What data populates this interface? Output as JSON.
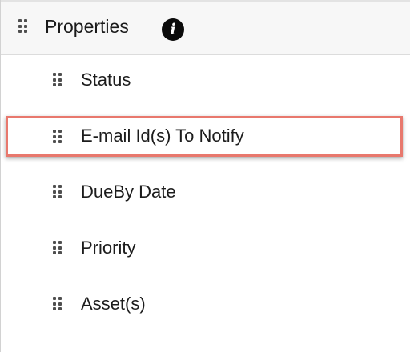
{
  "header": {
    "title": "Properties",
    "info_icon": "i"
  },
  "fields": [
    {
      "label": "Status"
    },
    {
      "label": "E-mail Id(s) To Notify",
      "highlighted": true
    },
    {
      "label": "DueBy Date"
    },
    {
      "label": "Priority"
    },
    {
      "label": "Asset(s)"
    }
  ],
  "colors": {
    "highlight_border": "#e8786d",
    "header_background": "#f7f7f7",
    "info_icon_background": "#0b0b0b"
  }
}
